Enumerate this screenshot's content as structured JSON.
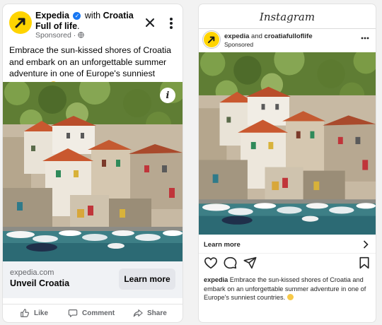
{
  "facebook_ad": {
    "advertiser": "Expedia",
    "with_text": "with",
    "partner": "Croatia Full of life",
    "sponsored": "Sponsored ·",
    "body": "Embrace the sun-kissed shores of Croatia and embark on an unforgettable summer adventure in one of Europe's sunniest countries.",
    "info_glyph": "i",
    "domain": "expedia.com",
    "headline": "Unveil Croatia",
    "cta": "Learn more",
    "actions": {
      "like": "Like",
      "comment": "Comment",
      "share": "Share"
    }
  },
  "instagram_ad": {
    "app_title": "Instagram",
    "author_primary": "expedia",
    "and_text": "and",
    "author_secondary": "croatiafulloflife",
    "sponsored": "Sponsored",
    "cta": "Learn more",
    "caption_user": "expedia",
    "caption_text": "Embrace the sun-kissed shores of Croatia and embark on an unforgettable summer adventure in one of Europe's sunniest countries."
  },
  "colors": {
    "expedia_yellow": "#ffd400",
    "verified_blue": "#1877f2",
    "fb_footer_bg": "#f0f2f5"
  },
  "icons": [
    "expedia-logo-icon",
    "verified-icon",
    "globe-icon",
    "close-icon",
    "more-icon",
    "info-icon",
    "like-icon",
    "comment-icon",
    "share-icon",
    "heart-icon",
    "comment-bubble-icon",
    "send-icon",
    "bookmark-icon",
    "chevron-right-icon"
  ]
}
